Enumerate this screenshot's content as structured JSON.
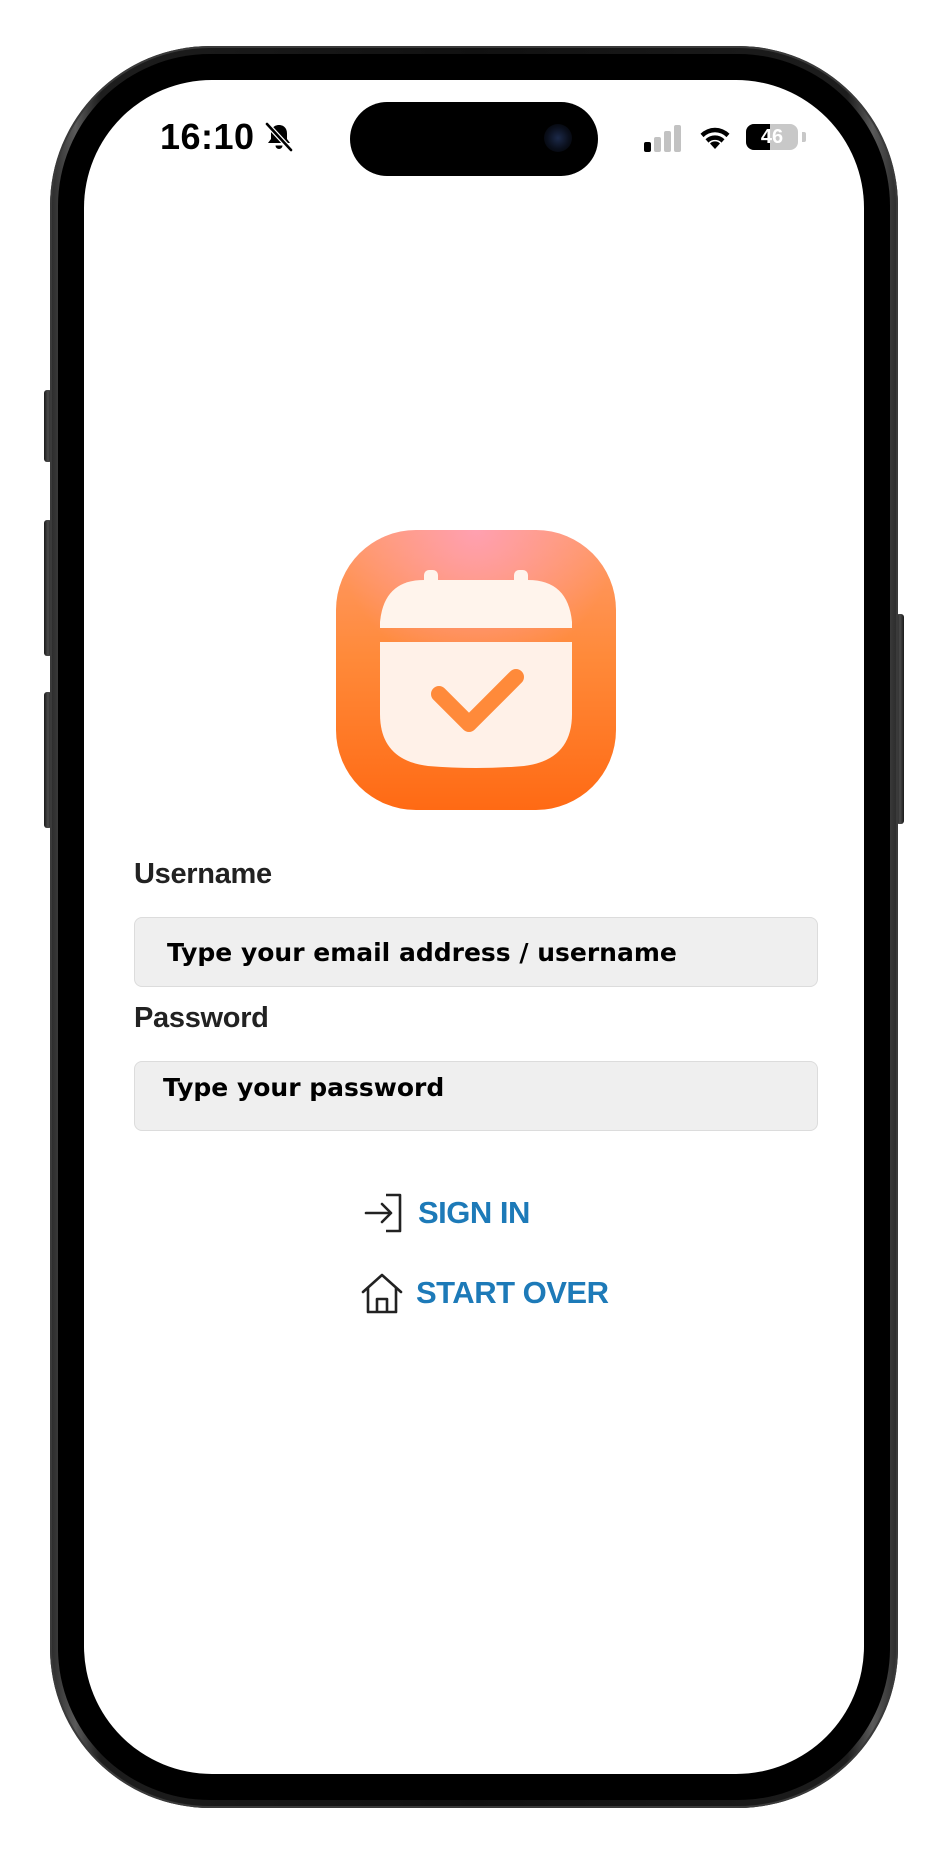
{
  "status_bar": {
    "time": "16:10",
    "battery_level": "46",
    "icons": [
      "bell-slash-icon",
      "cellular-signal-icon",
      "wifi-icon",
      "battery-icon"
    ]
  },
  "app": {
    "logo_icon": "calendar-check-icon",
    "colors": {
      "logo_top": "#ff9a6a",
      "logo_bottom": "#ff6a14",
      "link": "#1d7ab8"
    }
  },
  "login_form": {
    "username_label": "Username",
    "username_placeholder": "Type your email address / username",
    "password_label": "Password",
    "password_placeholder": "Type your password"
  },
  "actions": {
    "sign_in_label": "SIGN IN",
    "sign_in_icon": "sign-in-arrow-icon",
    "start_over_label": "START OVER",
    "start_over_icon": "home-icon"
  }
}
